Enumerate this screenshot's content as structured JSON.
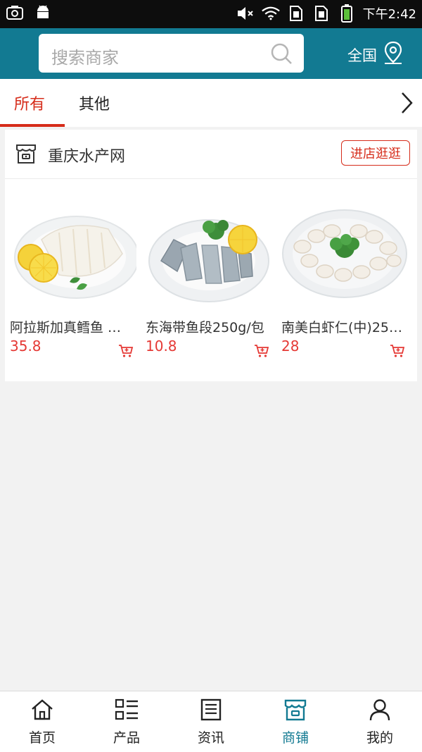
{
  "status_bar": {
    "time": "下午2:42",
    "icons": [
      "screenshot-icon",
      "android-icon",
      "mute-icon",
      "wifi-icon",
      "sim1-icon",
      "sim2-icon",
      "battery-icon"
    ]
  },
  "header": {
    "search_placeholder": "搜索商家",
    "region_label": "全国",
    "bg_color": "#127a92"
  },
  "tabs": [
    {
      "label": "所有",
      "active": true
    },
    {
      "label": "其他",
      "active": false
    }
  ],
  "shop": {
    "name": "重庆水产网",
    "enter_label": "进店逛逛",
    "products": [
      {
        "name": "阿拉斯加真鳕鱼 …",
        "price": "35.8"
      },
      {
        "name": "东海带鱼段250g/包",
        "price": "10.8"
      },
      {
        "name": "南美白虾仁(中)25…",
        "price": "28"
      }
    ]
  },
  "bottom_nav": [
    {
      "label": "首页",
      "icon": "home-icon",
      "active": false
    },
    {
      "label": "产品",
      "icon": "grid-list-icon",
      "active": false
    },
    {
      "label": "资讯",
      "icon": "news-icon",
      "active": false
    },
    {
      "label": "商铺",
      "icon": "shop-icon",
      "active": true
    },
    {
      "label": "我的",
      "icon": "user-icon",
      "active": false
    }
  ],
  "colors": {
    "accent": "#d62c1a",
    "price": "#e53935",
    "brand": "#127a92"
  }
}
